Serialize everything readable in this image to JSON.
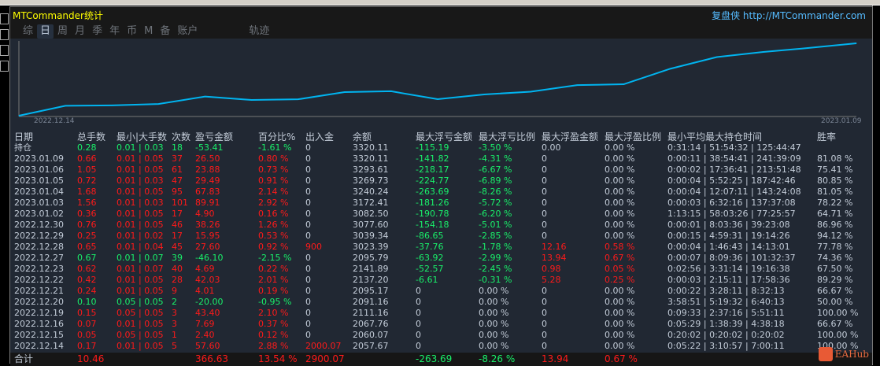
{
  "window": {
    "title": "MTCommander统计",
    "brand": "复盘侠 http://MTCommander.com"
  },
  "tabs": [
    {
      "label": "综"
    },
    {
      "label": "日",
      "active": true
    },
    {
      "label": "周"
    },
    {
      "label": "月"
    },
    {
      "label": "季"
    },
    {
      "label": "年"
    },
    {
      "label": "币"
    },
    {
      "label": "M"
    },
    {
      "label": "备"
    },
    {
      "label": "账户"
    },
    {
      "label": "轨迹"
    }
  ],
  "chart_data": {
    "type": "line",
    "x": [
      "",
      "2022.12.14",
      "2022.12.15",
      "2022.12.16",
      "2022.12.19",
      "2022.12.20",
      "2022.12.21",
      "2022.12.22",
      "2022.12.23",
      "2022.12.27",
      "2022.12.28",
      "2022.12.29",
      "2022.12.30",
      "2023.01.02",
      "2023.01.03",
      "2023.01.04",
      "2023.01.05",
      "2023.01.06",
      "2023.01.09"
    ],
    "y": [
      0,
      57.6,
      60.0,
      67.69,
      111.09,
      91.09,
      95.1,
      137.13,
      141.82,
      95.72,
      123.32,
      139.27,
      177.53,
      182.43,
      272.34,
      340.17,
      369.66,
      393.54,
      420.04
    ],
    "start_label": "2022.12.14",
    "end_label": "2023.01.09",
    "line_color": "#00b4f0",
    "grid": false
  },
  "table": {
    "headers": [
      "日期",
      "总手数",
      "最小|大手数",
      "次数",
      "盈亏金额",
      "百分比%",
      "出入金",
      "余额",
      "最大浮亏金额",
      "最大浮亏比例",
      "最大浮盈金额",
      "最大浮盈比例",
      "最小平均最大持仓时间",
      "胜率"
    ],
    "rows": [
      [
        "持仓",
        "0.28",
        "0.01 | 0.03",
        "18",
        "-53.41",
        "-1.61 %",
        "0",
        "3320.11",
        "-115.19",
        "-3.50 %",
        "0.00",
        "0.00 %",
        "0:31:14 | 51:54:32 | 125:44:47",
        ""
      ],
      [
        "2023.01.09",
        "0.66",
        "0.01 | 0.05",
        "37",
        "26.50",
        "0.80 %",
        "0",
        "3320.11",
        "-141.82",
        "-4.31 %",
        "0",
        "0.00 %",
        "0:00:11 | 38:54:41 | 241:39:09",
        "81.08 %"
      ],
      [
        "2023.01.06",
        "1.05",
        "0.01 | 0.05",
        "61",
        "23.88",
        "0.73 %",
        "0",
        "3293.61",
        "-218.17",
        "-6.67 %",
        "0",
        "0.00 %",
        "0:00:02 | 17:36:41 | 213:51:48",
        "75.41 %"
      ],
      [
        "2023.01.05",
        "0.72",
        "0.01 | 0.03",
        "47",
        "29.49",
        "0.91 %",
        "0",
        "3269.73",
        "-224.77",
        "-6.89 %",
        "0",
        "0.00 %",
        "0:00:04 | 5:52:25 | 187:42:46",
        "80.85 %"
      ],
      [
        "2023.01.04",
        "1.68",
        "0.01 | 0.05",
        "95",
        "67.83",
        "2.14 %",
        "0",
        "3240.24",
        "-263.69",
        "-8.26 %",
        "0",
        "0.00 %",
        "0:00:04 | 12:07:11 | 143:24:08",
        "81.05 %"
      ],
      [
        "2023.01.03",
        "1.56",
        "0.01 | 0.03",
        "101",
        "89.91",
        "2.92 %",
        "0",
        "3172.41",
        "-181.26",
        "-5.72 %",
        "0",
        "0.00 %",
        "0:00:03 | 6:32:16 | 137:37:08",
        "78.22 %"
      ],
      [
        "2023.01.02",
        "0.36",
        "0.01 | 0.05",
        "17",
        "4.90",
        "0.16 %",
        "0",
        "3082.50",
        "-190.78",
        "-6.20 %",
        "0",
        "0.00 %",
        "1:13:15 | 58:03:26 | 77:25:57",
        "64.71 %"
      ],
      [
        "2022.12.30",
        "0.76",
        "0.01 | 0.05",
        "46",
        "38.26",
        "1.26 %",
        "0",
        "3077.60",
        "-154.18",
        "-5.01 %",
        "0",
        "0.00 %",
        "0:00:01 | 8:03:36 | 39:23:08",
        "86.96 %"
      ],
      [
        "2022.12.29",
        "0.25",
        "0.01 | 0.02",
        "17",
        "15.95",
        "0.53 %",
        "0",
        "3039.34",
        "-86.65",
        "-2.85 %",
        "0",
        "0.00 %",
        "0:00:15 | 4:59:31 | 19:14:26",
        "94.12 %"
      ],
      [
        "2022.12.28",
        "0.65",
        "0.01 | 0.04",
        "45",
        "27.60",
        "0.92 %",
        "900",
        "3023.39",
        "-37.76",
        "-1.78 %",
        "12.16",
        "0.58 %",
        "0:00:04 | 1:46:43 | 14:13:01",
        "77.78 %"
      ],
      [
        "2022.12.27",
        "0.67",
        "0.01 | 0.07",
        "39",
        "-46.10",
        "-2.15 %",
        "0",
        "2095.79",
        "-63.92",
        "-2.99 %",
        "13.94",
        "0.67 %",
        "0:00:07 | 8:09:36 | 101:32:37",
        "74.36 %"
      ],
      [
        "2022.12.23",
        "0.62",
        "0.01 | 0.07",
        "40",
        "4.69",
        "0.22 %",
        "0",
        "2141.89",
        "-52.57",
        "-2.45 %",
        "0.98",
        "0.05 %",
        "0:02:56 | 3:31:14 | 19:16:38",
        "67.50 %"
      ],
      [
        "2022.12.22",
        "0.42",
        "0.01 | 0.05",
        "28",
        "42.03",
        "2.01 %",
        "0",
        "2137.20",
        "-6.61",
        "-0.31 %",
        "5.28",
        "0.25 %",
        "0:00:03 | 2:15:11 | 17:58:36",
        "89.29 %"
      ],
      [
        "2022.12.21",
        "0.24",
        "0.01 | 0.05",
        "9",
        "4.01",
        "0.19 %",
        "0",
        "2095.17",
        "0",
        "0.00 %",
        "0",
        "0.00 %",
        "0:00:22 | 3:28:11 | 8:32:13",
        "66.67 %"
      ],
      [
        "2022.12.20",
        "0.10",
        "0.05 | 0.05",
        "2",
        "-20.00",
        "-0.95 %",
        "0",
        "2091.16",
        "0",
        "0.00 %",
        "0",
        "0.00 %",
        "3:58:51 | 5:19:32 | 6:40:13",
        "50.00 %"
      ],
      [
        "2022.12.19",
        "0.15",
        "0.05 | 0.05",
        "3",
        "43.40",
        "2.10 %",
        "0",
        "2111.16",
        "0",
        "0.00 %",
        "0",
        "0.00 %",
        "0:09:33 | 2:37:16 | 5:51:11",
        "100.00 %"
      ],
      [
        "2022.12.16",
        "0.07",
        "0.01 | 0.05",
        "3",
        "7.69",
        "0.37 %",
        "0",
        "2067.76",
        "0",
        "0.00 %",
        "0",
        "0.00 %",
        "0:05:29 | 1:38:39 | 4:38:18",
        "66.67 %"
      ],
      [
        "2022.12.15",
        "0.05",
        "0.05 | 0.05",
        "1",
        "2.40",
        "0.12 %",
        "0",
        "2060.07",
        "0",
        "0.00 %",
        "0",
        "0.00 %",
        "0:20:02 | 0:20:02 | 0:20:02",
        "100.00 %"
      ],
      [
        "2022.12.14",
        "0.17",
        "0.01 | 0.05",
        "5",
        "57.60",
        "2.88 %",
        "2000.07",
        "2057.67",
        "0",
        "0.00 %",
        "0",
        "0.00 %",
        "0:05:22 | 3:10:57 | 7:00:11",
        "100.00 %"
      ]
    ],
    "total": [
      "合计",
      "10.46",
      "",
      "",
      "366.63",
      "13.54 %",
      "2900.07",
      "",
      "-263.69",
      "-8.26 %",
      "13.94",
      "0.67 %",
      "",
      ""
    ]
  },
  "colors": {
    "profit": "#ff1a1a",
    "loss": "#19f06a",
    "text": "#c3ccd8",
    "title": "#ffff00",
    "brand": "#55bbff"
  },
  "watermark": {
    "text": "EAHub"
  }
}
